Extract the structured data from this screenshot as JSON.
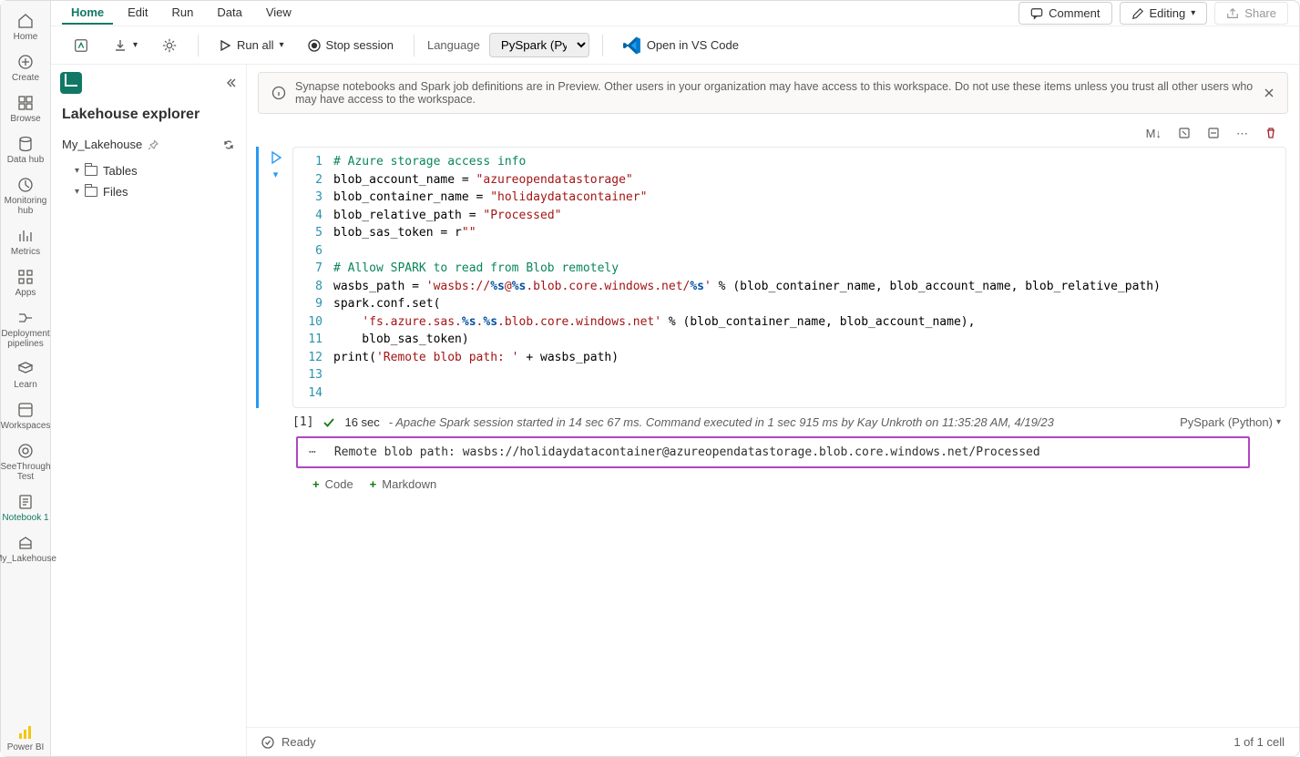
{
  "leftnav": [
    {
      "id": "home",
      "label": "Home"
    },
    {
      "id": "create",
      "label": "Create"
    },
    {
      "id": "browse",
      "label": "Browse"
    },
    {
      "id": "datahub",
      "label": "Data hub"
    },
    {
      "id": "monitoring",
      "label": "Monitoring hub"
    },
    {
      "id": "metrics",
      "label": "Metrics"
    },
    {
      "id": "apps",
      "label": "Apps"
    },
    {
      "id": "pipelines",
      "label": "Deployment pipelines"
    },
    {
      "id": "learn",
      "label": "Learn"
    },
    {
      "id": "workspaces",
      "label": "Workspaces"
    },
    {
      "id": "seethrough",
      "label": "SeeThrough Test"
    },
    {
      "id": "notebook1",
      "label": "Notebook 1",
      "active": true
    },
    {
      "id": "mylakehouse",
      "label": "My_Lakehouse"
    }
  ],
  "powerbi_label": "Power BI",
  "menubar": {
    "tabs": [
      "Home",
      "Edit",
      "Run",
      "Data",
      "View"
    ],
    "active": "Home",
    "comment": "Comment",
    "editing": "Editing",
    "share": "Share"
  },
  "toolbar": {
    "run_all": "Run all",
    "stop_session": "Stop session",
    "language_label": "Language",
    "language_value": "PySpark (Pytho…",
    "open_vscode": "Open in VS Code"
  },
  "sidebar": {
    "title": "Lakehouse explorer",
    "lakehouse_name": "My_Lakehouse",
    "tree": [
      "Tables",
      "Files"
    ]
  },
  "banner": "Synapse notebooks and Spark job definitions are in Preview. Other users in your organization may have access to this workspace. Do not use these items unless you trust all other users who may have access to the workspace.",
  "cell_tools": {
    "md": "M↓"
  },
  "code_lines": [
    [
      {
        "cls": "c-comment",
        "t": "# Azure storage access info"
      }
    ],
    [
      {
        "cls": "c-var",
        "t": "blob_account_name "
      },
      {
        "cls": "c-op",
        "t": "= "
      },
      {
        "cls": "c-str",
        "t": "\"azureopendatastorage\""
      }
    ],
    [
      {
        "cls": "c-var",
        "t": "blob_container_name "
      },
      {
        "cls": "c-op",
        "t": "= "
      },
      {
        "cls": "c-str",
        "t": "\"holidaydatacontainer\""
      }
    ],
    [
      {
        "cls": "c-var",
        "t": "blob_relative_path "
      },
      {
        "cls": "c-op",
        "t": "= "
      },
      {
        "cls": "c-str",
        "t": "\"Processed\""
      }
    ],
    [
      {
        "cls": "c-var",
        "t": "blob_sas_token "
      },
      {
        "cls": "c-op",
        "t": "= r"
      },
      {
        "cls": "c-str",
        "t": "\"\""
      }
    ],
    [],
    [
      {
        "cls": "c-comment",
        "t": "# Allow SPARK to read from Blob remotely"
      }
    ],
    [
      {
        "cls": "c-var",
        "t": "wasbs_path "
      },
      {
        "cls": "c-op",
        "t": "= "
      },
      {
        "cls": "c-str",
        "t": "'wasbs://"
      },
      {
        "cls": "c-int",
        "t": "%s"
      },
      {
        "cls": "c-str",
        "t": "@"
      },
      {
        "cls": "c-int",
        "t": "%s"
      },
      {
        "cls": "c-str",
        "t": ".blob.core.windows.net/"
      },
      {
        "cls": "c-int",
        "t": "%s"
      },
      {
        "cls": "c-str",
        "t": "'"
      },
      {
        "cls": "c-var",
        "t": " % (blob_container_name, blob_account_name, blob_relative_path)"
      }
    ],
    [
      {
        "cls": "c-var",
        "t": "spark.conf.set("
      }
    ],
    [
      {
        "cls": "c-var",
        "t": "    "
      },
      {
        "cls": "c-str",
        "t": "'fs.azure.sas."
      },
      {
        "cls": "c-int",
        "t": "%s"
      },
      {
        "cls": "c-str",
        "t": "."
      },
      {
        "cls": "c-int",
        "t": "%s"
      },
      {
        "cls": "c-str",
        "t": ".blob.core.windows.net'"
      },
      {
        "cls": "c-var",
        "t": " % (blob_container_name, blob_account_name),"
      }
    ],
    [
      {
        "cls": "c-var",
        "t": "    blob_sas_token)"
      }
    ],
    [
      {
        "cls": "c-var",
        "t": "print("
      },
      {
        "cls": "c-str",
        "t": "'Remote blob path: '"
      },
      {
        "cls": "c-var",
        "t": " + wasbs_path)"
      }
    ],
    [],
    []
  ],
  "cell_status": {
    "index": "[1]",
    "time": "16 sec",
    "msg": "- Apache Spark session started in 14 sec 67 ms. Command executed in 1 sec 915 ms by Kay Unkroth on 11:35:28 AM, 4/19/23",
    "lang": "PySpark (Python)"
  },
  "output_text": "Remote blob path: wasbs://holidaydatacontainer@azureopendatastorage.blob.core.windows.net/Processed",
  "add_cell": {
    "code": "Code",
    "markdown": "Markdown"
  },
  "statusbar": {
    "ready": "Ready",
    "cells": "1 of 1 cell"
  }
}
